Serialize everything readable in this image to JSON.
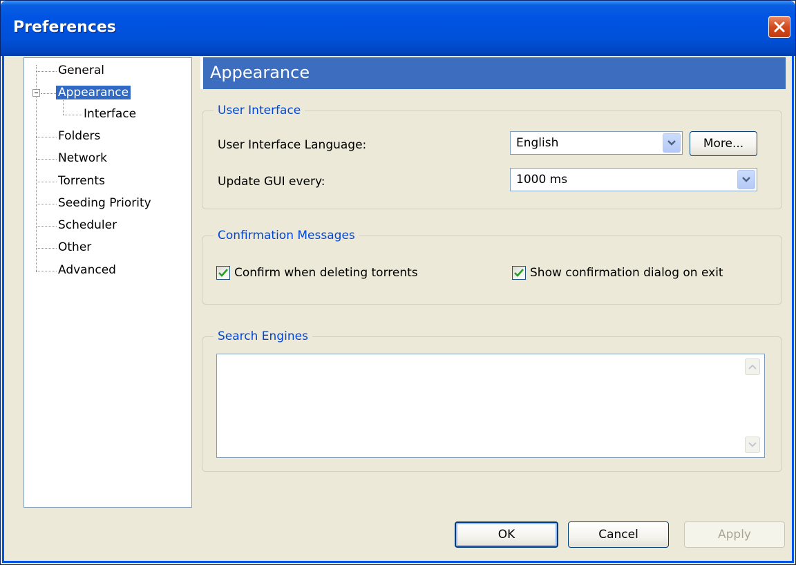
{
  "window": {
    "title": "Preferences"
  },
  "tree": {
    "items": [
      {
        "label": "General"
      },
      {
        "label": "Appearance",
        "selected": true,
        "expanded": true
      },
      {
        "label": "Interface"
      },
      {
        "label": "Folders"
      },
      {
        "label": "Network"
      },
      {
        "label": "Torrents"
      },
      {
        "label": "Seeding Priority"
      },
      {
        "label": "Scheduler"
      },
      {
        "label": "Other"
      },
      {
        "label": "Advanced"
      }
    ]
  },
  "header": {
    "title": "Appearance"
  },
  "user_interface": {
    "group_title": "User Interface",
    "language_label": "User Interface Language:",
    "language_value": "English",
    "more_button": "More...",
    "update_label": "Update GUI every:",
    "update_value": "1000 ms"
  },
  "confirmation": {
    "group_title": "Confirmation Messages",
    "confirm_delete_label": "Confirm when deleting torrents",
    "confirm_delete_checked": true,
    "confirm_exit_label": "Show confirmation dialog on exit",
    "confirm_exit_checked": true
  },
  "search_engines": {
    "group_title": "Search Engines",
    "content": ""
  },
  "buttons": {
    "ok": "OK",
    "cancel": "Cancel",
    "apply": "Apply"
  },
  "colors": {
    "accent": "#316ac5",
    "header": "#3d6dbf",
    "group_title": "#0046d5"
  },
  "icons": [
    "close-icon",
    "chevron-down-icon",
    "checkmark-icon",
    "minus-icon",
    "scroll-up-icon",
    "scroll-down-icon"
  ]
}
